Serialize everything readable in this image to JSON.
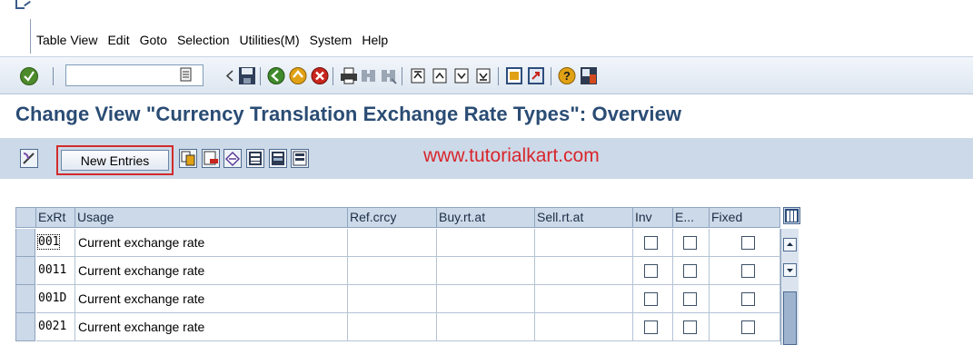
{
  "menu": [
    "Table View",
    "Edit",
    "Goto",
    "Selection",
    "Utilities(M)",
    "System",
    "Help"
  ],
  "title": "Change View \"Currency Translation Exchange Rate Types\": Overview",
  "app_toolbar": {
    "new_entries_label": "New Entries",
    "watermark": "www.tutorialkart.com"
  },
  "table": {
    "columns": [
      "ExRt",
      "Usage",
      "Ref.crcy",
      "Buy.rt.at",
      "Sell.rt.at",
      "Inv",
      "E...",
      "Fixed"
    ],
    "rows": [
      {
        "exrt": "001",
        "usage": "Current exchange rate",
        "ref_crcy": "",
        "buy_rt_at": "",
        "sell_rt_at": "",
        "inv": false,
        "e": false,
        "fixed": false
      },
      {
        "exrt": "0011",
        "usage": "Current exchange rate",
        "ref_crcy": "",
        "buy_rt_at": "",
        "sell_rt_at": "",
        "inv": false,
        "e": false,
        "fixed": false
      },
      {
        "exrt": "001D",
        "usage": "Current exchange rate",
        "ref_crcy": "",
        "buy_rt_at": "",
        "sell_rt_at": "",
        "inv": false,
        "e": false,
        "fixed": false
      },
      {
        "exrt": "0021",
        "usage": "Current exchange rate",
        "ref_crcy": "",
        "buy_rt_at": "",
        "sell_rt_at": "",
        "inv": false,
        "e": false,
        "fixed": false
      }
    ]
  },
  "colors": {
    "title_text": "#2a4c74",
    "toolbar_bg": "#ccd9e8",
    "highlight_border": "#d22b2b",
    "watermark": "#d8262c"
  },
  "icons": {
    "system_toolbar": [
      "enter-icon",
      "command-history-icon",
      "back-arrow-icon",
      "save-icon",
      "back-icon",
      "exit-icon",
      "cancel-icon",
      "print-icon",
      "find-icon",
      "find-next-icon",
      "first-page-icon",
      "previous-page-icon",
      "next-page-icon",
      "last-page-icon",
      "create-session-icon",
      "shortcut-icon",
      "help-icon",
      "customize-layout-icon"
    ],
    "application_toolbar": [
      "display-change-icon",
      "copy-as-icon",
      "delete-icon",
      "undo-change-icon",
      "select-all-icon",
      "select-block-icon",
      "deselect-all-icon"
    ]
  }
}
